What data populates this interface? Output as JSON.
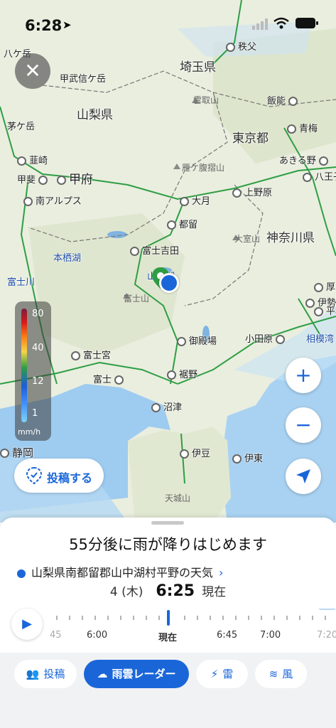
{
  "status_bar": {
    "time": "6:28"
  },
  "map": {
    "prefectures": [
      "埼玉県",
      "山梨県",
      "東京都",
      "神奈川県"
    ],
    "places": [
      "秩父",
      "八ケ岳",
      "甲武信ケ岳",
      "茅ケ岳",
      "雲取山",
      "飯能",
      "青梅",
      "韮崎",
      "あきる野",
      "甲斐",
      "甲府",
      "八王子",
      "南アルプス",
      "大月",
      "上野原",
      "雁ケ腹摺山",
      "都留",
      "大室山",
      "富士吉田",
      "本栖湖",
      "山中湖",
      "富士山",
      "御殿場",
      "小田原",
      "富士宮",
      "富士",
      "裾野",
      "沼津",
      "伊豆",
      "伊東",
      "静岡",
      "天城山",
      "相模湾",
      "伊勢原",
      "厚",
      "平塚",
      "富士川"
    ],
    "rain_legend": {
      "levels": [
        "80",
        "40",
        "12",
        "1"
      ],
      "unit": "mm/h"
    }
  },
  "buttons": {
    "close": "✕",
    "zoom_in": "+",
    "zoom_out": "−",
    "post": "投稿する"
  },
  "forecast": {
    "headline": "55分後に雨が降りはじめます",
    "location": "山梨県南都留郡山中湖村平野の天気",
    "date": "4 (木)",
    "time": "6:25",
    "now_label": "現在",
    "timeline_labels": [
      "45",
      "6:00",
      "現在",
      "6:45",
      "7:00",
      "7:20"
    ]
  },
  "tabs": [
    "投稿",
    "雨雲レーダー",
    "雷",
    "風"
  ],
  "colors": {
    "accent": "#1a66d9",
    "rail": "#2e9e44"
  }
}
